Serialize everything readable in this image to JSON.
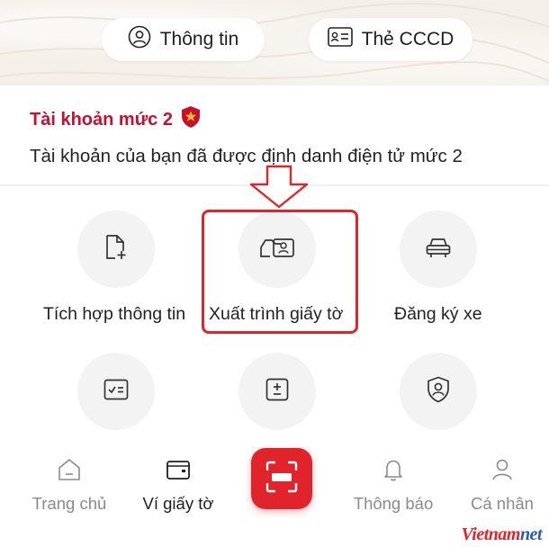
{
  "header": {
    "info_label": "Thông tin",
    "cccd_label": "Thẻ CCCD"
  },
  "account": {
    "title": "Tài khoản mức 2",
    "description": "Tài khoản của bạn đã được định danh điện tử mức 2"
  },
  "features": [
    {
      "label": "Tích hợp thông tin",
      "icon": "file-add-icon"
    },
    {
      "label": "Xuất trình giấy tờ",
      "icon": "present-document-icon",
      "highlighted": true
    },
    {
      "label": "Đăng ký xe",
      "icon": "car-icon"
    },
    {
      "label": "",
      "icon": "checklist-icon"
    },
    {
      "label": "",
      "icon": "plus-minus-icon"
    },
    {
      "label": "",
      "icon": "shield-user-icon"
    }
  ],
  "tabbar": {
    "items": [
      {
        "label": "Trang chủ",
        "icon": "home-icon",
        "active": false
      },
      {
        "label": "Ví giấy tờ",
        "icon": "wallet-icon",
        "active": true
      },
      {
        "label": "Thông báo",
        "icon": "bell-icon",
        "active": false
      },
      {
        "label": "Cá nhân",
        "icon": "user-icon",
        "active": false
      }
    ],
    "scan_icon": "scan-icon"
  },
  "watermark": {
    "part1": "Vietnam",
    "part2": "net"
  },
  "colors": {
    "accent": "#e1242c",
    "account_title": "#c8102e",
    "tile_bg": "#f3f3f3",
    "header_bg": "#f4efe8"
  }
}
